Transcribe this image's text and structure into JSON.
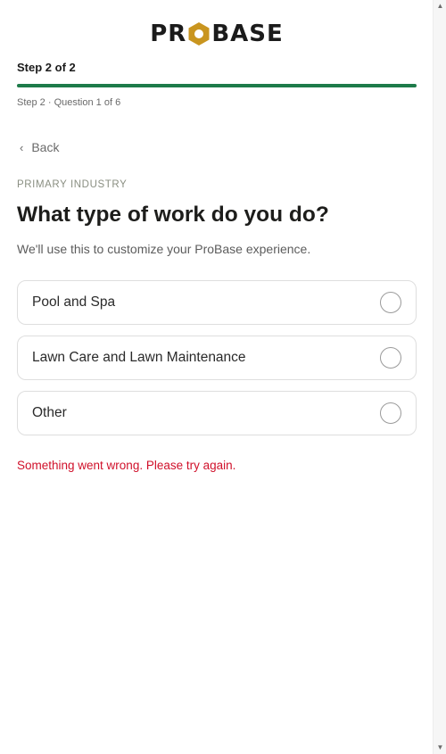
{
  "brand": {
    "logo_text_left": "PR",
    "logo_text_right": "BASE",
    "logo_accent_color": "#c9951f"
  },
  "progress": {
    "step_label": "Step 2 of 2",
    "fraction": 1.0,
    "bar_color": "#1e7b4a",
    "sub_label": "Step 2 · Question 1 of 6"
  },
  "nav": {
    "back_icon": "chevron-left-icon",
    "back_label": "Back"
  },
  "question": {
    "eyebrow": "PRIMARY INDUSTRY",
    "title": "What type of work do you do?",
    "subtitle": "We'll use this to customize your ProBase experience.",
    "options": [
      {
        "label": "Pool and Spa",
        "selected": false
      },
      {
        "label": "Lawn Care and Lawn Maintenance",
        "selected": false
      },
      {
        "label": "Other",
        "selected": false
      }
    ]
  },
  "error": {
    "message": "Something went wrong. Please try again.",
    "color": "#d0102a"
  }
}
